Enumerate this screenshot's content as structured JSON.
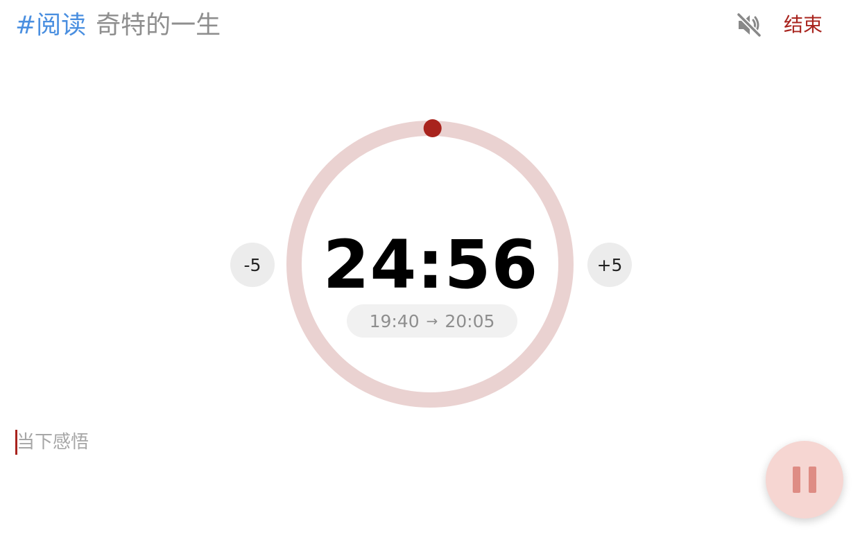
{
  "header": {
    "tag": "#阅读",
    "task_name": "奇特的一生"
  },
  "controls": {
    "mute_icon": "speaker-muted-icon",
    "end_label": "结束",
    "minus_label": "-5",
    "plus_label": "+5",
    "pause_icon": "pause-icon"
  },
  "timer": {
    "remaining": "24:56",
    "start_time": "19:40",
    "arrow": "→",
    "end_time": "20:05",
    "elapsed_fraction": 0.003
  },
  "reflection": {
    "placeholder": "当下感悟",
    "value": ""
  },
  "colors": {
    "accent": "#a8231d",
    "tag": "#4a8fe0",
    "ring_track": "#ead2d1",
    "pause_bg": "#f6d6d2",
    "pause_icon": "#de8c84"
  }
}
